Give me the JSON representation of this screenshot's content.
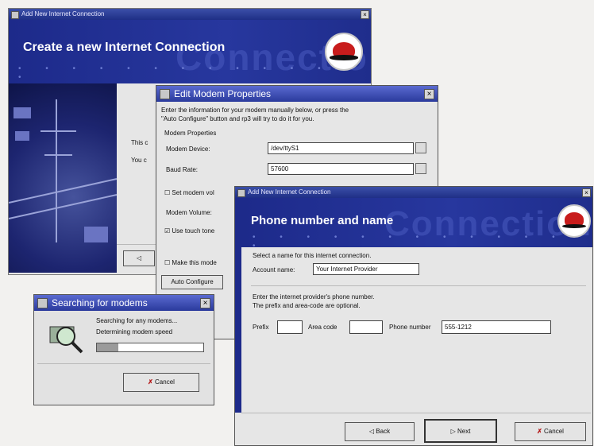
{
  "back_window": {
    "title": "Add New Internet Connection",
    "heading": "Create a new Internet Connection",
    "ghost_text": "Connection",
    "partial_lines": [
      "This c",
      "You c"
    ]
  },
  "modem_window": {
    "title": "Edit Modem Properties",
    "intro_line1": "Enter the information for your modem manually below, or press the",
    "intro_line2": "\"Auto Configure\" button and rp3 will try to do it for you.",
    "group_label": "Modem Properties",
    "device_label": "Modem Device:",
    "device_value": "/dev/ttyS1",
    "baud_label": "Baud Rate:",
    "baud_value": "57600",
    "set_volume_label": "Set modem vol",
    "volume_label": "Modem Volume:",
    "touch_tone_label": "Use touch tone",
    "make_default_label": "Make this mode",
    "auto_configure_label": "Auto Configure"
  },
  "search_window": {
    "title": "Searching for modems",
    "status_line1": "Searching for any modems...",
    "status_line2": "Determining modem speed",
    "progress": 0.2,
    "cancel_label": "Cancel"
  },
  "phone_window": {
    "title": "Add New Internet Connection",
    "heading": "Phone number and name",
    "ghost_text": "Connection",
    "select_name_text": "Select a name for this internet connection.",
    "account_label": "Account name:",
    "account_value": "Your Internet Provider",
    "phone_info_line1": "Enter the internet provider's phone number.",
    "phone_info_line2": "The prefix and area-code are optional.",
    "prefix_label": "Prefix",
    "prefix_value": "",
    "area_code_label": "Area code",
    "area_code_value": "",
    "phone_label": "Phone number",
    "phone_value": "555-1212",
    "back_label": "Back",
    "next_label": "Next",
    "cancel_label": "Cancel"
  }
}
